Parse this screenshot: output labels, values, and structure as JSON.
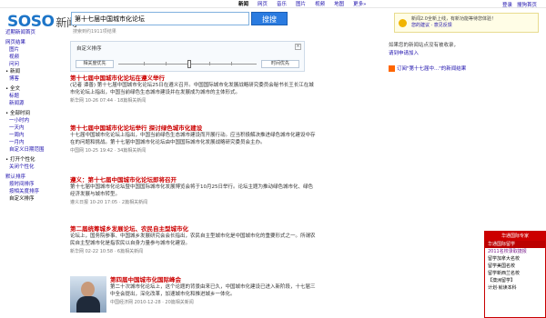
{
  "topnav": [
    "新闻",
    "网页",
    "音乐",
    "图片",
    "视频",
    "地图",
    "更多»"
  ],
  "topnav_active_index": 0,
  "account": {
    "login": "登录",
    "help": "搜狗首页"
  },
  "logo": {
    "latin": "SOSO",
    "cn": "新闻"
  },
  "search": {
    "value": "第十七届中国城市化论坛",
    "button": "搜搜",
    "count_text": "搜索到约1911项结果"
  },
  "sidebar": {
    "top_link": "近期新闻首页",
    "groups": [
      {
        "head": "网页结果",
        "items": [
          "图片",
          "视频",
          "问问"
        ]
      },
      {
        "head": "• 新闻",
        "items": [
          "博客"
        ]
      },
      {
        "head": "• 全文",
        "items": [
          "标题"
        ]
      },
      {
        "head": "新闻源",
        "items": []
      },
      {
        "head": "• 全部时间",
        "items": [
          "一小时内",
          "一天内",
          "一周内",
          "一月内",
          "自定义日期范围"
        ]
      },
      {
        "head": "• 打开个性化",
        "items": [
          "关闭个性化"
        ]
      },
      {
        "head": "默认排序",
        "items": [
          "按时间排序",
          "按相关度排序",
          "自定义排序"
        ]
      }
    ]
  },
  "panel": {
    "title": "自定义排序",
    "close": "×",
    "left_btn": "相关度优先",
    "right_btn": "时间优先"
  },
  "results": [
    {
      "title": "第十七届中国城市化论坛在遵义举行",
      "snippet": "(记者 谭善) 第十七届中国城市化论坛25日在遵义召开。中国国际城市化发展战略研究委员会秘书长王长江在城市化论坛上指出，中国当前绿色生态城市建设并在发展成为城市的主体形式。",
      "meta": "新华网 10-26 07:44 · 18篇相关新闻"
    },
    {
      "title": "第十七届中国城市化论坛举行 探讨绿色城市化建设",
      "snippet": "十七届中国城市化论坛上指出，中国当前绿色生态城市建设而开展行动。应当积极解决推进绿色城市化建设中存在的问题和挑战。第十七届中国城市化论坛由中国国际城市化发展战略研究委员会主办。",
      "meta": "中国网 10-25 19:42 · 34篇相关新闻"
    },
    {
      "title": "遵义：第十七届中国城市化论坛即将召开",
      "snippet": "第十七届中国城市化论坛暨中国国际城市化发展博览会将于10月25日举行。论坛主题为推动绿色城市化、绿色经济发展与城市转型。",
      "meta": "遵义日报 10-20 17:05 · 2篇相关新闻"
    },
    {
      "title": "第二届统筹城乡发展论坛、农民自主型城市化",
      "snippet": "论坛上，国务院参事、中国城乡发展研究会会长指出，农民自主型城市化是中国城市化的重要形式之一。所谓农民自主型城市化是指农民以自身力量参与城市化建设。",
      "meta": "新华网 02-22 10:58 · 6篇相关新闻"
    },
    {
      "title": "第四届中国城市化国际峰会",
      "snippet": "第二十次城市化论坛上，这个论题的背景由来已久，中国城市化建设已进入新阶段，十七届三中全会提出，深化改革，加速城市化和推进城乡一体化。",
      "meta": "中国经济网 2010-12-28 · 20篇相关新闻"
    }
  ],
  "notice": {
    "line1": "新闻2.0全新上线，有新功能等待您体验！",
    "line2": "您的建议 · 意见反馈"
  },
  "right": {
    "q1": "如果您的新闻站点没有被收录，",
    "q2": "请到申请加入",
    "rss": "订阅\"第十七届中...\"的新闻结果"
  },
  "ad": {
    "head": "华通国际专家",
    "lines": [
      "华通国际留学",
      "2011名校录取捷报",
      "留学加拿大名校",
      "留学美国名校",
      "留学新西兰名校",
      "【澳洲留学】",
      "计划·就读本科"
    ]
  },
  "colors": {
    "accent": "#2a7be0",
    "title_red": "#cc0000",
    "link": "#1a0dab"
  }
}
